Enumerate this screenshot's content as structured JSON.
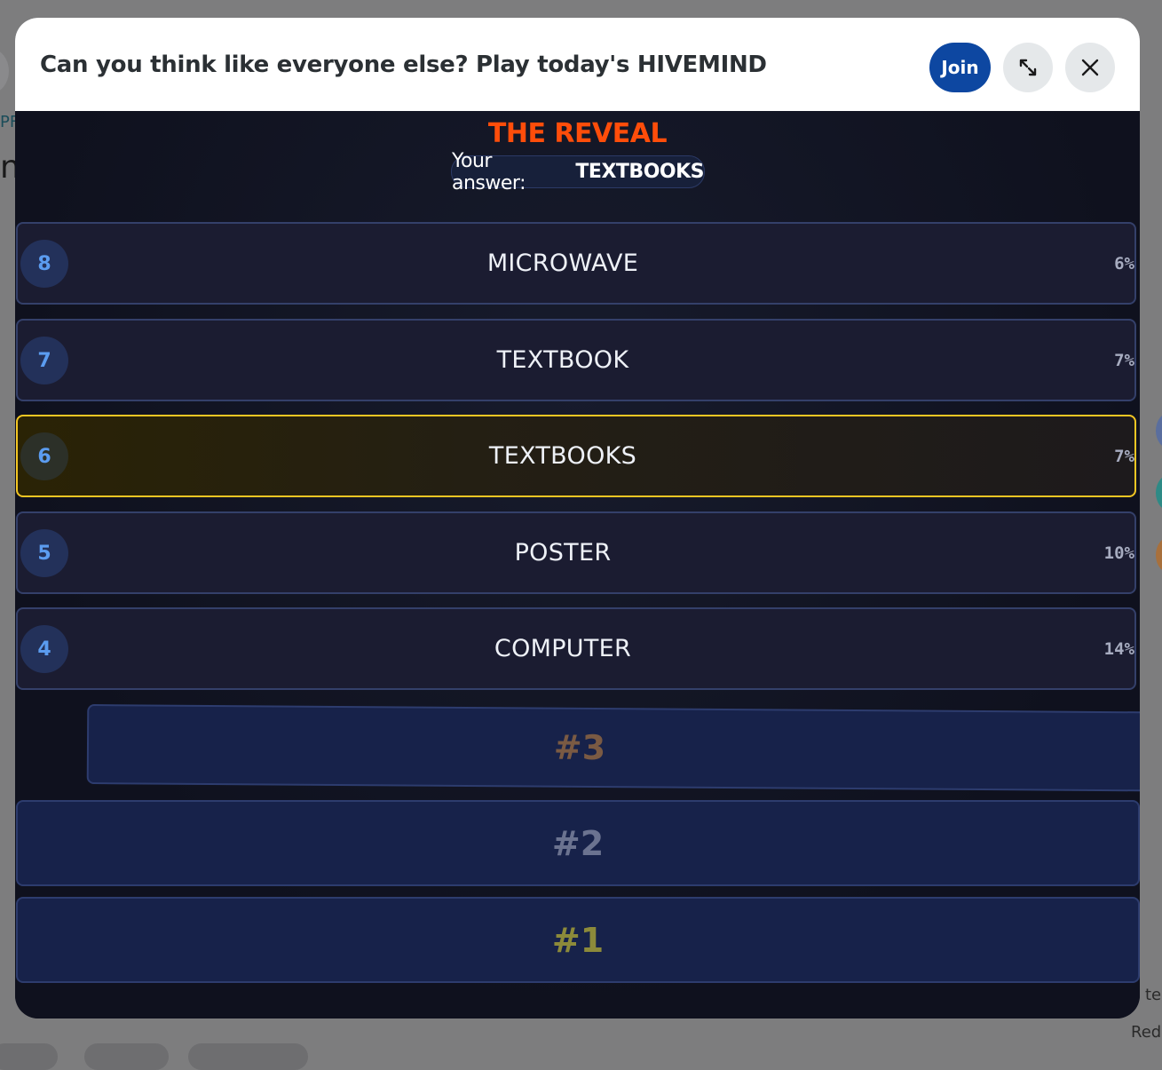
{
  "modal": {
    "title": "Can you think like everyone else? Play today's HIVEMIND",
    "join_label": "Join"
  },
  "game": {
    "heading": "THE REVEAL",
    "your_answer_label": "Your answer:",
    "your_answer_value": "TEXTBOOKS",
    "rows": [
      {
        "rank": "8",
        "answer": "MICROWAVE",
        "percent": "6%"
      },
      {
        "rank": "7",
        "answer": "TEXTBOOK",
        "percent": "7%"
      },
      {
        "rank": "6",
        "answer": "TEXTBOOKS",
        "percent": "7%"
      },
      {
        "rank": "5",
        "answer": "POSTER",
        "percent": "10%"
      },
      {
        "rank": "4",
        "answer": "COMPUTER",
        "percent": "14%"
      }
    ],
    "hidden": [
      {
        "label": "#3",
        "color": "#7a5a43"
      },
      {
        "label": "#2",
        "color": "#6b7390"
      },
      {
        "label": "#1",
        "color": "#8c8a3a"
      }
    ],
    "highlight_color": "#f3c623"
  },
  "colors": {
    "join_bg": "#0d47a1",
    "reveal_heading": "#ff4d0a",
    "rank_text": "#5b9cf0"
  },
  "background": {
    "left_fragment": "PF",
    "left_fragment_2": "n",
    "right_fragment": "Red",
    "right_fragment_2": "ted"
  }
}
